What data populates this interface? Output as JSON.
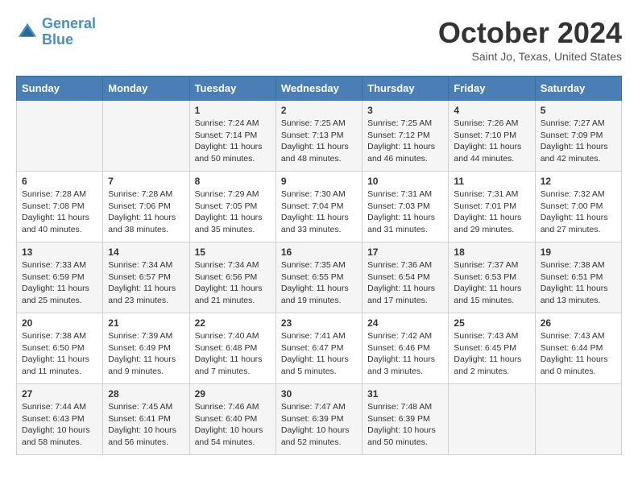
{
  "header": {
    "logo_line1": "General",
    "logo_line2": "Blue",
    "month_title": "October 2024",
    "subtitle": "Saint Jo, Texas, United States"
  },
  "days_of_week": [
    "Sunday",
    "Monday",
    "Tuesday",
    "Wednesday",
    "Thursday",
    "Friday",
    "Saturday"
  ],
  "weeks": [
    [
      {
        "day": "",
        "info": ""
      },
      {
        "day": "",
        "info": ""
      },
      {
        "day": "1",
        "info": "Sunrise: 7:24 AM\nSunset: 7:14 PM\nDaylight: 11 hours and 50 minutes."
      },
      {
        "day": "2",
        "info": "Sunrise: 7:25 AM\nSunset: 7:13 PM\nDaylight: 11 hours and 48 minutes."
      },
      {
        "day": "3",
        "info": "Sunrise: 7:25 AM\nSunset: 7:12 PM\nDaylight: 11 hours and 46 minutes."
      },
      {
        "day": "4",
        "info": "Sunrise: 7:26 AM\nSunset: 7:10 PM\nDaylight: 11 hours and 44 minutes."
      },
      {
        "day": "5",
        "info": "Sunrise: 7:27 AM\nSunset: 7:09 PM\nDaylight: 11 hours and 42 minutes."
      }
    ],
    [
      {
        "day": "6",
        "info": "Sunrise: 7:28 AM\nSunset: 7:08 PM\nDaylight: 11 hours and 40 minutes."
      },
      {
        "day": "7",
        "info": "Sunrise: 7:28 AM\nSunset: 7:06 PM\nDaylight: 11 hours and 38 minutes."
      },
      {
        "day": "8",
        "info": "Sunrise: 7:29 AM\nSunset: 7:05 PM\nDaylight: 11 hours and 35 minutes."
      },
      {
        "day": "9",
        "info": "Sunrise: 7:30 AM\nSunset: 7:04 PM\nDaylight: 11 hours and 33 minutes."
      },
      {
        "day": "10",
        "info": "Sunrise: 7:31 AM\nSunset: 7:03 PM\nDaylight: 11 hours and 31 minutes."
      },
      {
        "day": "11",
        "info": "Sunrise: 7:31 AM\nSunset: 7:01 PM\nDaylight: 11 hours and 29 minutes."
      },
      {
        "day": "12",
        "info": "Sunrise: 7:32 AM\nSunset: 7:00 PM\nDaylight: 11 hours and 27 minutes."
      }
    ],
    [
      {
        "day": "13",
        "info": "Sunrise: 7:33 AM\nSunset: 6:59 PM\nDaylight: 11 hours and 25 minutes."
      },
      {
        "day": "14",
        "info": "Sunrise: 7:34 AM\nSunset: 6:57 PM\nDaylight: 11 hours and 23 minutes."
      },
      {
        "day": "15",
        "info": "Sunrise: 7:34 AM\nSunset: 6:56 PM\nDaylight: 11 hours and 21 minutes."
      },
      {
        "day": "16",
        "info": "Sunrise: 7:35 AM\nSunset: 6:55 PM\nDaylight: 11 hours and 19 minutes."
      },
      {
        "day": "17",
        "info": "Sunrise: 7:36 AM\nSunset: 6:54 PM\nDaylight: 11 hours and 17 minutes."
      },
      {
        "day": "18",
        "info": "Sunrise: 7:37 AM\nSunset: 6:53 PM\nDaylight: 11 hours and 15 minutes."
      },
      {
        "day": "19",
        "info": "Sunrise: 7:38 AM\nSunset: 6:51 PM\nDaylight: 11 hours and 13 minutes."
      }
    ],
    [
      {
        "day": "20",
        "info": "Sunrise: 7:38 AM\nSunset: 6:50 PM\nDaylight: 11 hours and 11 minutes."
      },
      {
        "day": "21",
        "info": "Sunrise: 7:39 AM\nSunset: 6:49 PM\nDaylight: 11 hours and 9 minutes."
      },
      {
        "day": "22",
        "info": "Sunrise: 7:40 AM\nSunset: 6:48 PM\nDaylight: 11 hours and 7 minutes."
      },
      {
        "day": "23",
        "info": "Sunrise: 7:41 AM\nSunset: 6:47 PM\nDaylight: 11 hours and 5 minutes."
      },
      {
        "day": "24",
        "info": "Sunrise: 7:42 AM\nSunset: 6:46 PM\nDaylight: 11 hours and 3 minutes."
      },
      {
        "day": "25",
        "info": "Sunrise: 7:43 AM\nSunset: 6:45 PM\nDaylight: 11 hours and 2 minutes."
      },
      {
        "day": "26",
        "info": "Sunrise: 7:43 AM\nSunset: 6:44 PM\nDaylight: 11 hours and 0 minutes."
      }
    ],
    [
      {
        "day": "27",
        "info": "Sunrise: 7:44 AM\nSunset: 6:43 PM\nDaylight: 10 hours and 58 minutes."
      },
      {
        "day": "28",
        "info": "Sunrise: 7:45 AM\nSunset: 6:41 PM\nDaylight: 10 hours and 56 minutes."
      },
      {
        "day": "29",
        "info": "Sunrise: 7:46 AM\nSunset: 6:40 PM\nDaylight: 10 hours and 54 minutes."
      },
      {
        "day": "30",
        "info": "Sunrise: 7:47 AM\nSunset: 6:39 PM\nDaylight: 10 hours and 52 minutes."
      },
      {
        "day": "31",
        "info": "Sunrise: 7:48 AM\nSunset: 6:39 PM\nDaylight: 10 hours and 50 minutes."
      },
      {
        "day": "",
        "info": ""
      },
      {
        "day": "",
        "info": ""
      }
    ]
  ]
}
